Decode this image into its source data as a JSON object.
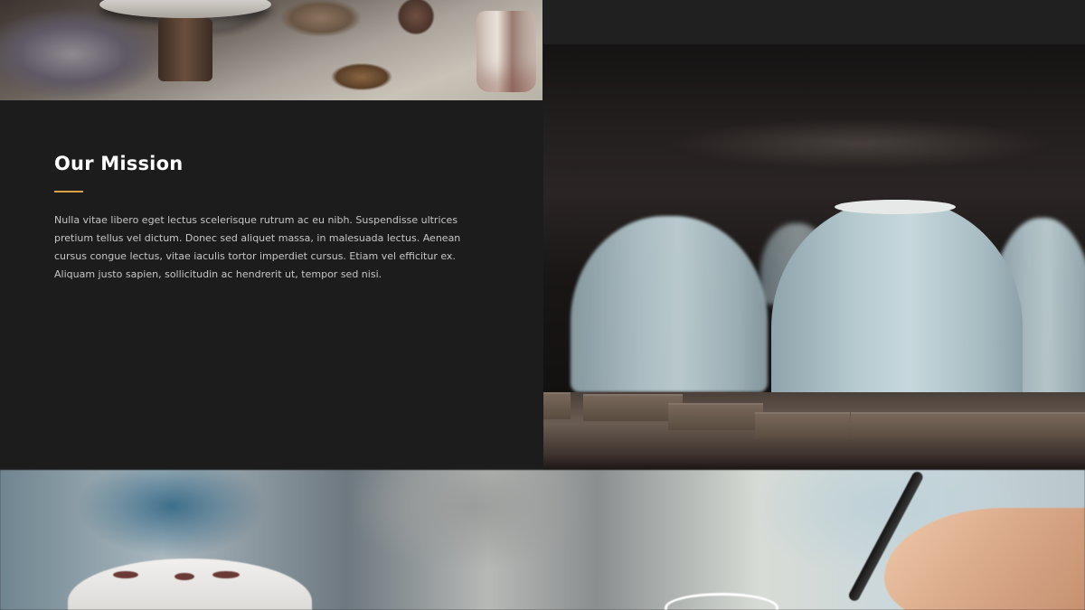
{
  "mission": {
    "title": "Our Mission",
    "body": "Nulla vitae libero eget lectus scelerisque rutrum ac eu nibh. Suspendisse ultrices pretium tellus vel dictum. Donec sed aliquet massa, in malesuada lectus. Aenean cursus congue lectus, vitae iaculis tortor imperdiet cursus. Etiam vel efficitur ex. Aliquam justo sapien, sollicitudin ac hendrerit ut, tempor sed nisi."
  },
  "colors": {
    "background": "#1c1c1c",
    "accent": "#d9a245",
    "heading": "#ffffff",
    "body_text": "#c7c7c7"
  },
  "images": {
    "top_left": "pottery-workbench-photo",
    "right": "ceramic-cups-on-shelf-photo",
    "bottom": "painting-pottery-photo"
  }
}
